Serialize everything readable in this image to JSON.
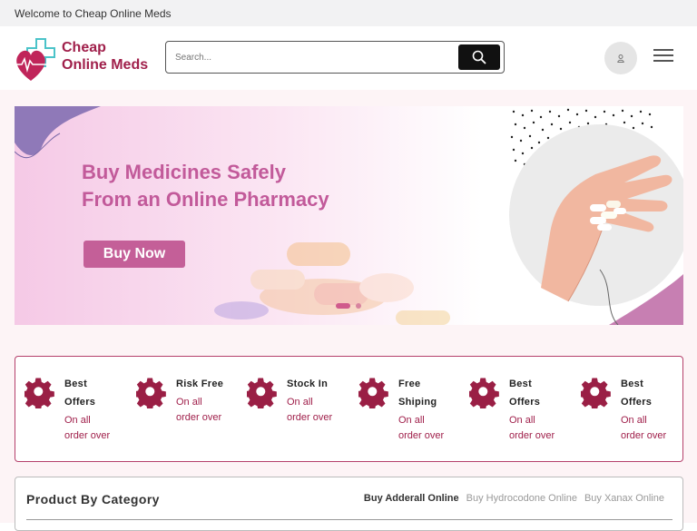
{
  "topbar": {
    "welcome": "Welcome to Cheap Online Meds"
  },
  "header": {
    "logo_line1": "Cheap",
    "logo_line2": "Online Meds",
    "search_placeholder": "Search...",
    "user_icon": "user-icon",
    "menu_icon": "hamburger-menu-icon"
  },
  "hero": {
    "title_line1": "Buy Medicines Safely",
    "title_line2": "From an Online Pharmacy",
    "button": "Buy Now"
  },
  "features": [
    {
      "title1": "Best",
      "title2": "Offers",
      "sub1": "On all",
      "sub2": "order over"
    },
    {
      "title1": "Risk Free",
      "title2": "",
      "sub1": "On all",
      "sub2": "order over"
    },
    {
      "title1": "Stock In",
      "title2": "",
      "sub1": "On all",
      "sub2": "order over"
    },
    {
      "title1": "Free",
      "title2": "Shiping",
      "sub1": "On all",
      "sub2": "order over"
    },
    {
      "title1": "Best",
      "title2": "Offers",
      "sub1": "On all",
      "sub2": "order over"
    },
    {
      "title1": "Best",
      "title2": "Offers",
      "sub1": "On all",
      "sub2": "order over"
    }
  ],
  "category": {
    "title": "Product By Category",
    "tabs": [
      "Buy Adderall Online",
      "Buy Hydrocodone Online",
      "Buy Xanax Online"
    ]
  },
  "colors": {
    "brand": "#a0204b",
    "accent": "#c45f98",
    "border": "#b5406b"
  }
}
